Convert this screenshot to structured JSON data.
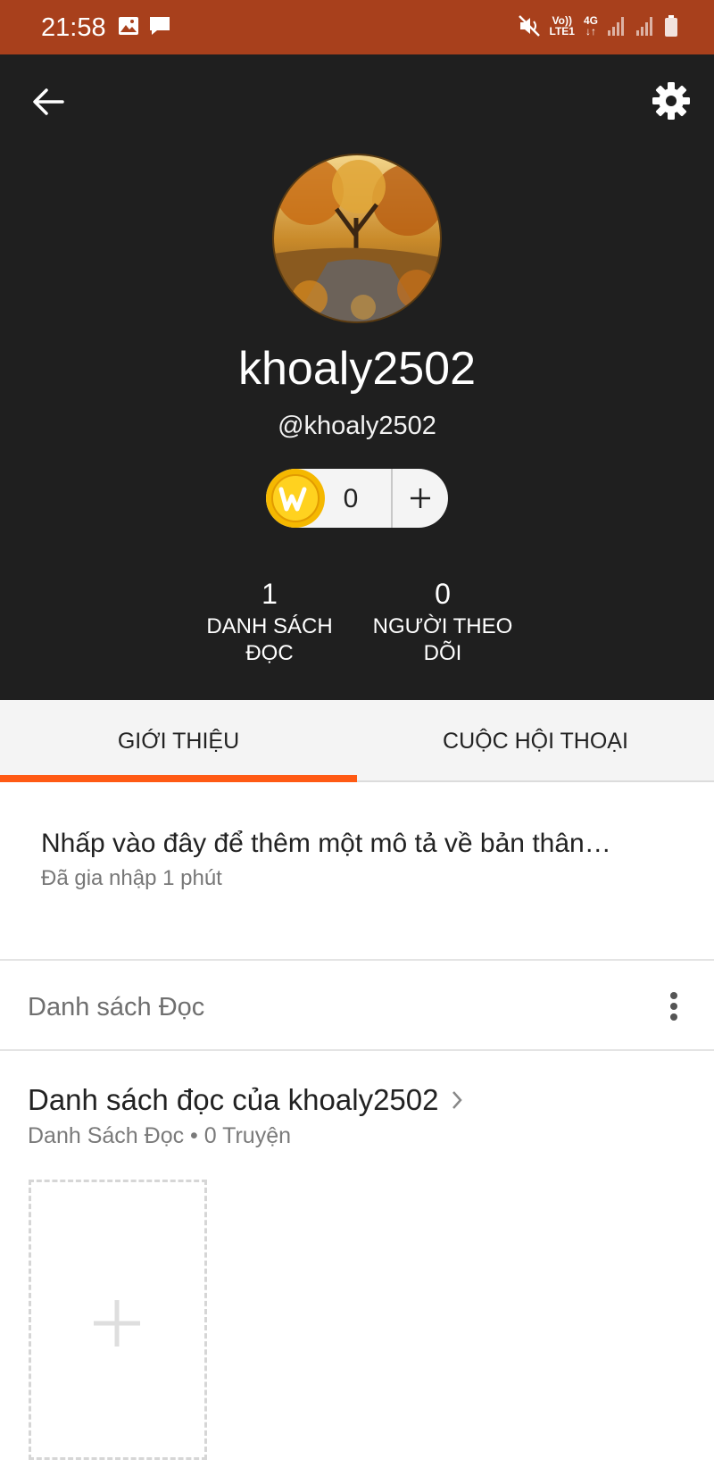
{
  "status_bar": {
    "time": "21:58",
    "left_icons": [
      "image-icon",
      "message-icon"
    ],
    "right_icons": [
      "mute-icon",
      "volte-icon",
      "4g-icon",
      "signal-icon",
      "signal-icon",
      "battery-icon"
    ],
    "volte_label": "Vo)) LTE1",
    "network_label": "4G"
  },
  "header": {
    "username": "khoaly2502",
    "handle": "@khoaly2502",
    "coins": "0",
    "stats": [
      {
        "value": "1",
        "label_line1": "DANH SÁCH",
        "label_line2": "ĐỌC"
      },
      {
        "value": "0",
        "label_line1": "NGƯỜI THEO",
        "label_line2": "DÕI"
      }
    ]
  },
  "tabs": [
    {
      "label": "GIỚI THIỆU",
      "active": true
    },
    {
      "label": "CUỘC HỘI THOẠI",
      "active": false
    }
  ],
  "about": {
    "description_placeholder": "Nhấp vào đây để thêm một mô tả về bản thân…",
    "joined": "Đã gia nhập 1 phút"
  },
  "reading_lists": {
    "section_title": "Danh sách Đọc",
    "items": [
      {
        "name": "Danh sách đọc của khoaly2502",
        "subtitle": "Danh Sách Đọc • 0 Truyện"
      }
    ]
  },
  "colors": {
    "status_bar": "#a8401c",
    "header_bg": "#1f1f1f",
    "accent": "#ff5a14",
    "coin": "#f5b800"
  }
}
